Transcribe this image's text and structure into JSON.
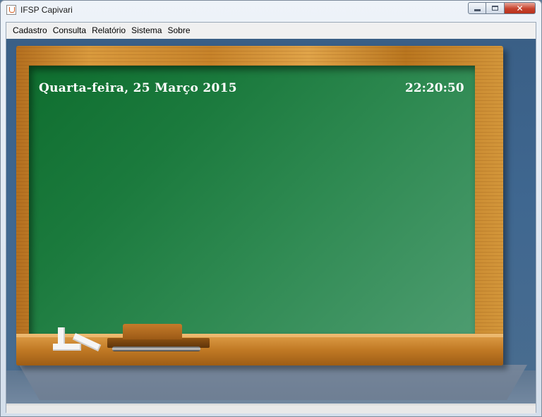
{
  "window": {
    "title": "IFSP Capivari",
    "controls": {
      "minimize": "",
      "maximize": "",
      "close": "✕"
    }
  },
  "menubar": {
    "items": [
      "Cadastro",
      "Consulta",
      "Relatório",
      "Sistema",
      "Sobre"
    ]
  },
  "chalkboard": {
    "date": "Quarta-feira, 25 Março 2015",
    "time": "22:20:50"
  },
  "colors": {
    "board_green": "#1b7a3d",
    "frame_wood": "#c7832a",
    "background_blue": "#3f6790"
  }
}
